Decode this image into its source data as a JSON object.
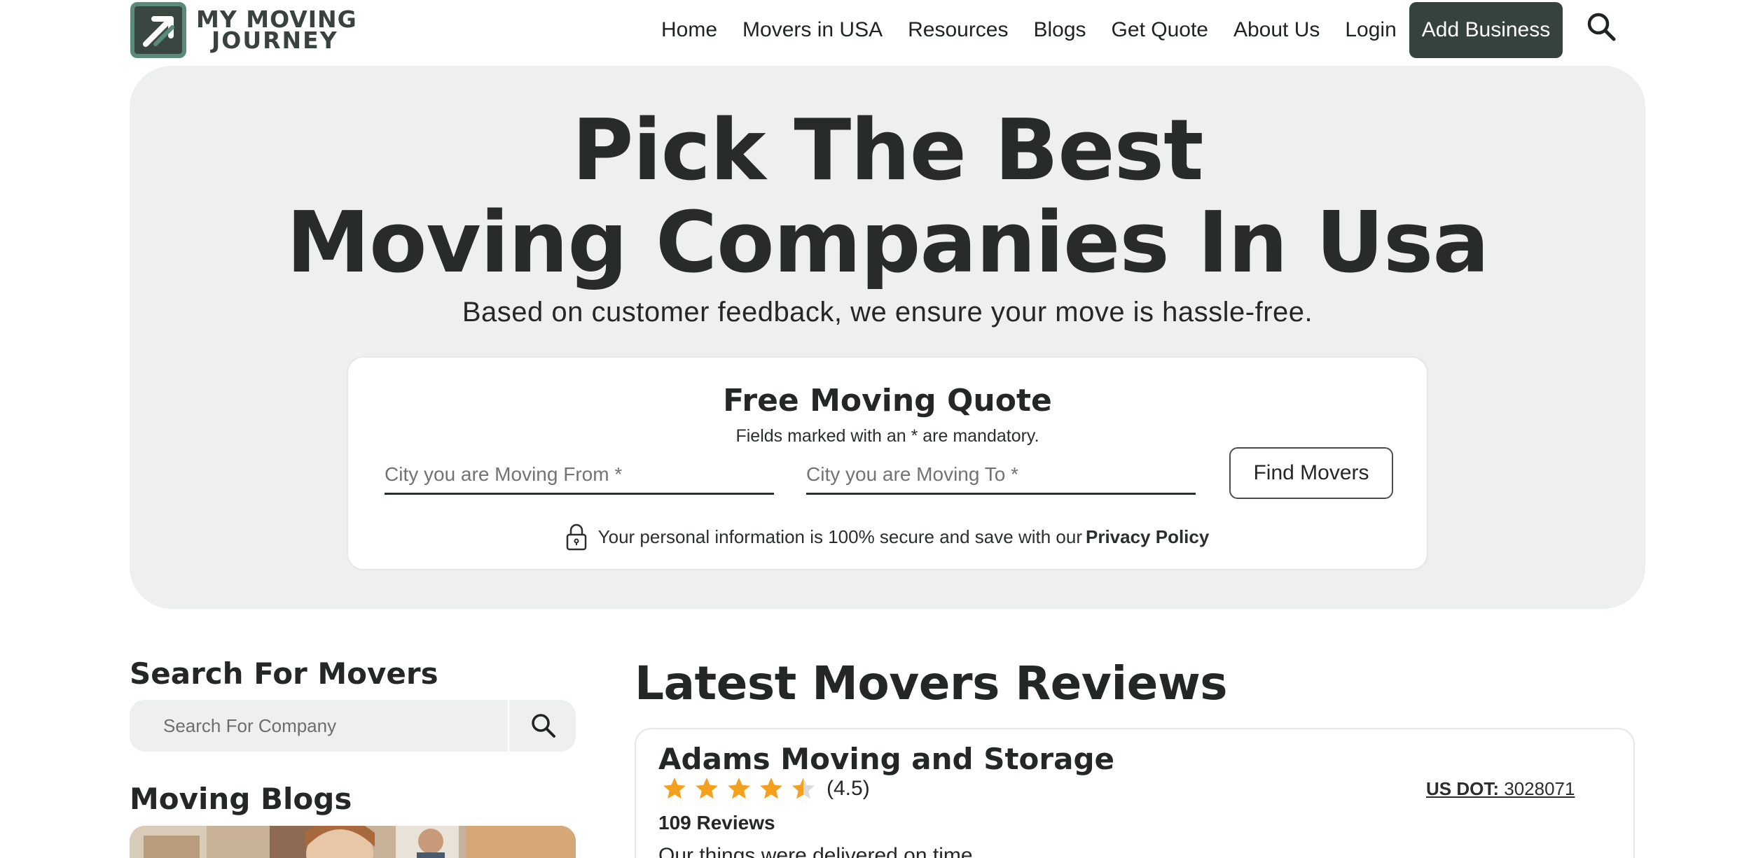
{
  "header": {
    "logo_line1": "MY MOVING",
    "logo_line2": "JOURNEY",
    "nav": [
      "Home",
      "Movers in USA",
      "Resources",
      "Blogs",
      "Get Quote",
      "About Us",
      "Login"
    ],
    "add_business": "Add Business",
    "search_icon": "search-icon"
  },
  "hero": {
    "title_line1": "Pick The Best",
    "title_line2": "Moving Companies In Usa",
    "subtitle": "Based on customer feedback, we ensure your move is hassle-free."
  },
  "quote": {
    "title": "Free Moving Quote",
    "note": "Fields marked with an * are mandatory.",
    "from_placeholder": "City you are Moving From *",
    "to_placeholder": "City you are Moving To *",
    "from_value": "",
    "to_value": "",
    "button": "Find Movers",
    "secure_text": "Your personal information is 100% secure and save with our",
    "privacy_link": "Privacy Policy",
    "lock_icon": "lock-icon"
  },
  "sidebar": {
    "search_heading": "Search For Movers",
    "search_placeholder": "Search For Company",
    "search_value": "",
    "blogs_heading": "Moving Blogs"
  },
  "reviews": {
    "heading": "Latest Movers Reviews",
    "items": [
      {
        "company": "Adams Moving and Storage",
        "rating": 4.5,
        "rating_text": "(4.5)",
        "reviews_count": "109 Reviews",
        "excerpt": "Our things were delivered on time",
        "usdot_label": "US DOT:",
        "usdot_value": "3028071"
      }
    ]
  },
  "colors": {
    "accent_dark": "#36433c",
    "hero_bg": "#eef0ef",
    "star": "#f2a01e",
    "logo_green": "#5b8a78"
  }
}
